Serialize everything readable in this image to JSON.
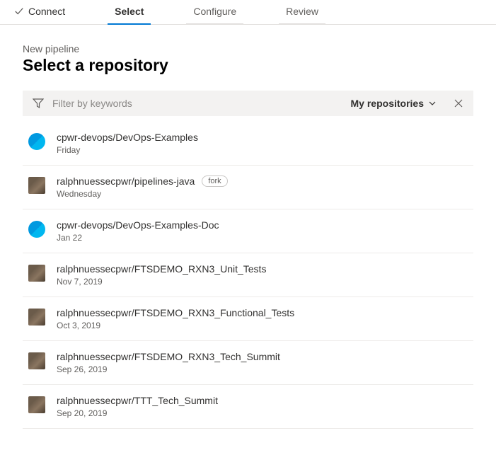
{
  "wizard": {
    "steps": {
      "connect": "Connect",
      "select": "Select",
      "configure": "Configure",
      "review": "Review"
    }
  },
  "page": {
    "eyebrow": "New pipeline",
    "title": "Select a repository"
  },
  "filter": {
    "placeholder": "Filter by keywords",
    "dropdown_label": "My repositories"
  },
  "repos": [
    {
      "name": "cpwr-devops/DevOps-Examples",
      "date": "Friday",
      "avatar": "org",
      "badge": ""
    },
    {
      "name": "ralphnuessecpwr/pipelines-java",
      "date": "Wednesday",
      "avatar": "user",
      "badge": "fork"
    },
    {
      "name": "cpwr-devops/DevOps-Examples-Doc",
      "date": "Jan 22",
      "avatar": "org",
      "badge": ""
    },
    {
      "name": "ralphnuessecpwr/FTSDEMO_RXN3_Unit_Tests",
      "date": "Nov 7, 2019",
      "avatar": "user",
      "badge": ""
    },
    {
      "name": "ralphnuessecpwr/FTSDEMO_RXN3_Functional_Tests",
      "date": "Oct 3, 2019",
      "avatar": "user",
      "badge": ""
    },
    {
      "name": "ralphnuessecpwr/FTSDEMO_RXN3_Tech_Summit",
      "date": "Sep 26, 2019",
      "avatar": "user",
      "badge": ""
    },
    {
      "name": "ralphnuessecpwr/TTT_Tech_Summit",
      "date": "Sep 20, 2019",
      "avatar": "user",
      "badge": ""
    }
  ]
}
